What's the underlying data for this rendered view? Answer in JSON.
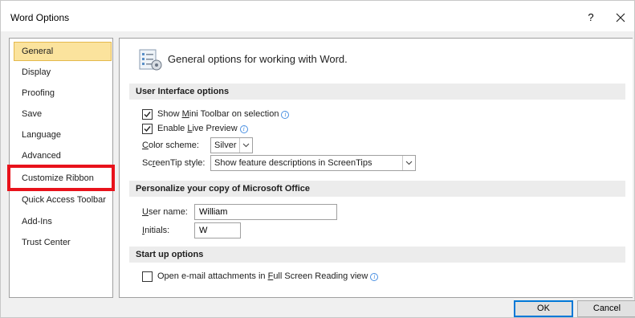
{
  "window": {
    "title": "Word Options",
    "help": "?"
  },
  "nav": {
    "items": [
      {
        "label": "General"
      },
      {
        "label": "Display"
      },
      {
        "label": "Proofing"
      },
      {
        "label": "Save"
      },
      {
        "label": "Language"
      },
      {
        "label": "Advanced"
      },
      {
        "label": "Customize Ribbon"
      },
      {
        "label": "Quick Access Toolbar"
      },
      {
        "label": "Add-Ins"
      },
      {
        "label": "Trust Center"
      }
    ],
    "selected": "General",
    "highlighted": "Customize Ribbon",
    "highlight_color": "#e8121b"
  },
  "header": {
    "text": "General options for working with Word."
  },
  "sections": {
    "ui": {
      "title": "User Interface options",
      "mini_toolbar": {
        "pre": "Show ",
        "accel": "M",
        "post": "ini Toolbar on selection",
        "checked": true
      },
      "live_preview": {
        "pre": "Enable ",
        "accel": "L",
        "post": "ive Preview",
        "checked": true
      },
      "color_scheme": {
        "label_accel": "C",
        "label_rest": "olor scheme:",
        "value": "Silver"
      },
      "screentip": {
        "label_pre": "Sc",
        "label_accel": "r",
        "label_post": "eenTip style:",
        "value": "Show feature descriptions in ScreenTips"
      }
    },
    "personalize": {
      "title": "Personalize your copy of Microsoft Office",
      "username": {
        "label_accel": "U",
        "label_rest": "ser name:",
        "value": "William"
      },
      "initials": {
        "label_accel": "I",
        "label_rest": "nitials:",
        "value": "W"
      }
    },
    "startup": {
      "title": "Start up options",
      "full_screen": {
        "pre": "Open e-mail attachments in ",
        "accel": "F",
        "post": "ull Screen Reading view",
        "checked": false
      }
    }
  },
  "buttons": {
    "ok": "OK",
    "cancel": "Cancel"
  },
  "icons": {
    "close": "close-icon",
    "info": "info-icon",
    "dropdown": "chevron-down-icon",
    "options": "options-icon"
  },
  "colors": {
    "selected_bg": "#fbe39d",
    "section_bg": "#ececec",
    "info_blue": "#4a90e2"
  }
}
